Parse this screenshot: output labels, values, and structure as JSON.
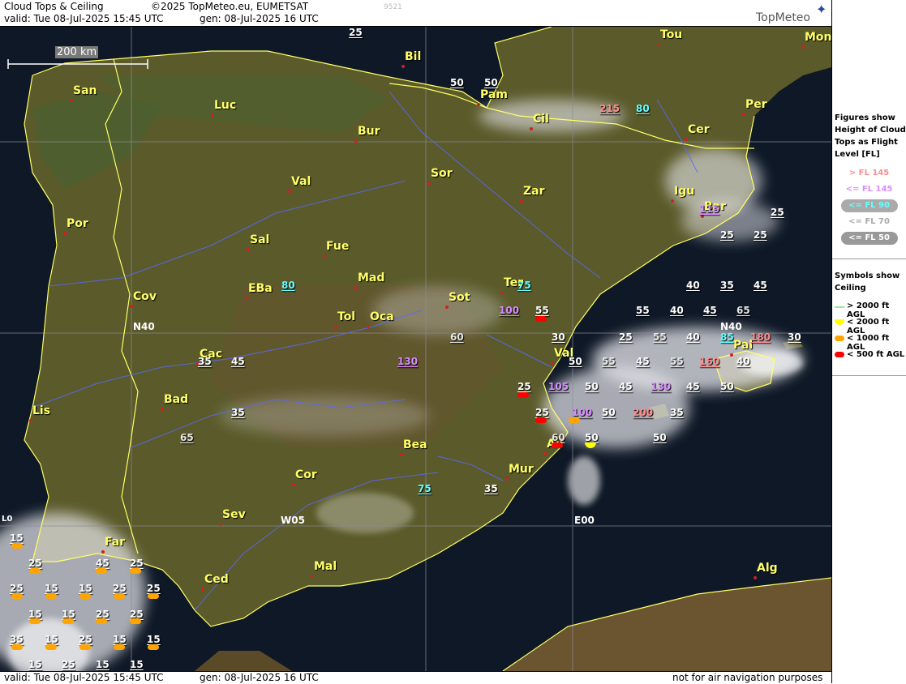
{
  "header": {
    "title": "Cloud Tops & Ceiling",
    "copyright": "©2025 TopMeteo.eu, EUMETSAT",
    "valid": "valid:  Tue   08-Jul-2025  15:45 UTC",
    "gen": "gen:  08-Jul-2025 16 UTC",
    "code": "9521",
    "logo": "TopMeteo"
  },
  "footer": {
    "valid": "valid:  Tue   08-Jul-2025  15:45 UTC",
    "gen": "gen:  08-Jul-2025 16 UTC",
    "disclaimer": "not for air navigation purposes"
  },
  "scale_label": "200 km",
  "grid_labels": [
    "N40",
    "N40",
    "W05",
    "E00",
    "L0"
  ],
  "colors": {
    "gt145": "#ff8c8c",
    "le145": "#d98cff",
    "le90": "#66ffff",
    "le70": "#e6e6e6",
    "le50": "#ffffff",
    "city": "#ffff66",
    "ceil_gt2000": "#90ee90",
    "ceil_lt2000": "#ffff00",
    "ceil_lt1000": "#ffa500",
    "ceil_lt500": "#ff0000"
  },
  "cities": [
    "San",
    "Luc",
    "Bil",
    "Pam",
    "Tou",
    "Mon",
    "Bur",
    "Cil",
    "Per",
    "Cer",
    "Por",
    "Val",
    "Sor",
    "Zar",
    "Igu",
    "Bar",
    "Sal",
    "Fue",
    "Mad",
    "EBa",
    "Cov",
    "Ter",
    "Sot",
    "Tol",
    "Oca",
    "Cac",
    "Val",
    "Pal",
    "Bad",
    "Lis",
    "Bea",
    "Mur",
    "Ali",
    "Cor",
    "Sev",
    "Far",
    "Mal",
    "Ced",
    "Alg"
  ],
  "figures": [
    {
      "v": "25",
      "c": "le50"
    },
    {
      "v": "50",
      "c": "le50"
    },
    {
      "v": "50",
      "c": "le50"
    },
    {
      "v": "215",
      "c": "gt145"
    },
    {
      "v": "80",
      "c": "le90"
    },
    {
      "v": "115",
      "c": "le145"
    },
    {
      "v": "25",
      "c": "le50"
    },
    {
      "v": "25",
      "c": "le50"
    },
    {
      "v": "25",
      "c": "le50"
    },
    {
      "v": "80",
      "c": "le90"
    },
    {
      "v": "75",
      "c": "le90"
    },
    {
      "v": "100",
      "c": "le145"
    },
    {
      "v": "55",
      "c": "le50"
    },
    {
      "v": "40",
      "c": "le50"
    },
    {
      "v": "35",
      "c": "le50"
    },
    {
      "v": "45",
      "c": "le50"
    },
    {
      "v": "55",
      "c": "le50"
    },
    {
      "v": "40",
      "c": "le50"
    },
    {
      "v": "45",
      "c": "le50"
    },
    {
      "v": "65",
      "c": "le70"
    },
    {
      "v": "60",
      "c": "le70"
    },
    {
      "v": "30",
      "c": "le50"
    },
    {
      "v": "25",
      "c": "le50"
    },
    {
      "v": "55",
      "c": "le70"
    },
    {
      "v": "40",
      "c": "le50"
    },
    {
      "v": "85",
      "c": "le90"
    },
    {
      "v": "180",
      "c": "gt145"
    },
    {
      "v": "30",
      "c": "le50"
    },
    {
      "v": "35",
      "c": "le50"
    },
    {
      "v": "45",
      "c": "le50"
    },
    {
      "v": "130",
      "c": "le145"
    },
    {
      "v": "50",
      "c": "le50"
    },
    {
      "v": "55",
      "c": "le70"
    },
    {
      "v": "45",
      "c": "le50"
    },
    {
      "v": "55",
      "c": "le70"
    },
    {
      "v": "160",
      "c": "gt145"
    },
    {
      "v": "40",
      "c": "le50"
    },
    {
      "v": "25",
      "c": "le50"
    },
    {
      "v": "105",
      "c": "le145"
    },
    {
      "v": "50",
      "c": "le50"
    },
    {
      "v": "45",
      "c": "le50"
    },
    {
      "v": "130",
      "c": "le145"
    },
    {
      "v": "45",
      "c": "le50"
    },
    {
      "v": "50",
      "c": "le50"
    },
    {
      "v": "35",
      "c": "le50"
    },
    {
      "v": "25",
      "c": "le50"
    },
    {
      "v": "100",
      "c": "le145"
    },
    {
      "v": "50",
      "c": "le50"
    },
    {
      "v": "200",
      "c": "gt145"
    },
    {
      "v": "35",
      "c": "le50"
    },
    {
      "v": "65",
      "c": "le70"
    },
    {
      "v": "60",
      "c": "le70"
    },
    {
      "v": "50",
      "c": "le50"
    },
    {
      "v": "50",
      "c": "le50"
    },
    {
      "v": "75",
      "c": "le90"
    },
    {
      "v": "35",
      "c": "le50"
    },
    {
      "v": "15",
      "c": "le50"
    },
    {
      "v": "25",
      "c": "le50"
    },
    {
      "v": "45",
      "c": "le50"
    },
    {
      "v": "25",
      "c": "le50"
    },
    {
      "v": "25",
      "c": "le50"
    },
    {
      "v": "15",
      "c": "le50"
    },
    {
      "v": "15",
      "c": "le50"
    },
    {
      "v": "25",
      "c": "le50"
    },
    {
      "v": "25",
      "c": "le50"
    },
    {
      "v": "15",
      "c": "le50"
    },
    {
      "v": "15",
      "c": "le50"
    },
    {
      "v": "25",
      "c": "le50"
    },
    {
      "v": "25",
      "c": "le50"
    },
    {
      "v": "35",
      "c": "le50"
    },
    {
      "v": "15",
      "c": "le50"
    },
    {
      "v": "25",
      "c": "le50"
    },
    {
      "v": "15",
      "c": "le50"
    },
    {
      "v": "15",
      "c": "le50"
    },
    {
      "v": "15",
      "c": "le50"
    },
    {
      "v": "25",
      "c": "le50"
    },
    {
      "v": "15",
      "c": "le50"
    },
    {
      "v": "15",
      "c": "le50"
    }
  ],
  "legend": {
    "figures_title": "Figures show Height of Cloud Tops as Flight Level  [FL]",
    "fl_items": [
      "> FL 145",
      "<= FL 145",
      "<= FL 90",
      "<= FL 70",
      "<= FL 50"
    ],
    "symbols_title": "Symbols show Ceiling",
    "ceil_items": [
      "> 2000 ft AGL",
      "< 2000 ft AGL",
      "< 1000 ft AGL",
      "< 500 ft AGL"
    ]
  }
}
